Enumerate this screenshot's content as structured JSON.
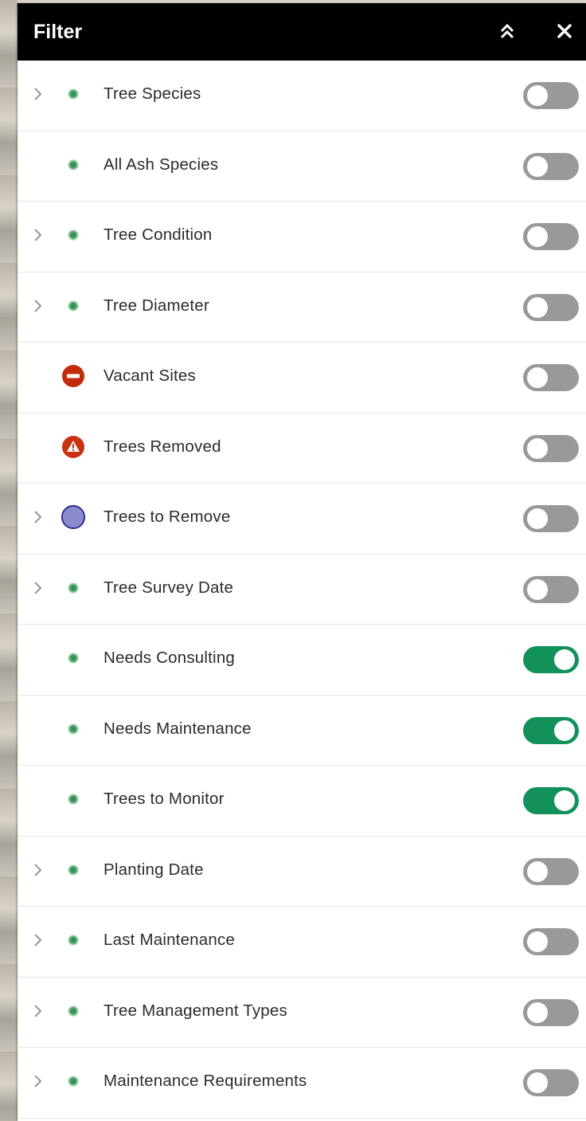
{
  "panel": {
    "title": "Filter",
    "collapse_icon": "double-chevron-up-icon",
    "close_icon": "close-icon"
  },
  "colors": {
    "header_bg": "#000000",
    "toggle_on": "#12915a",
    "toggle_off": "#999999",
    "tree_symbol": "#3e9c5c",
    "vacant_symbol": "#c22b0a",
    "removed_symbol": "#c8320f",
    "to_remove_symbol": "#8a8acc"
  },
  "filters": [
    {
      "label": "Tree Species",
      "expandable": true,
      "symbol": "tree-dot-icon",
      "enabled": false
    },
    {
      "label": "All Ash Species",
      "expandable": false,
      "symbol": "tree-dot-icon",
      "enabled": false
    },
    {
      "label": "Tree Condition",
      "expandable": true,
      "symbol": "tree-dot-icon",
      "enabled": false
    },
    {
      "label": "Tree Diameter",
      "expandable": true,
      "symbol": "tree-dot-icon",
      "enabled": false
    },
    {
      "label": "Vacant Sites",
      "expandable": false,
      "symbol": "no-entry-icon",
      "enabled": false
    },
    {
      "label": "Trees Removed",
      "expandable": false,
      "symbol": "warning-icon",
      "enabled": false
    },
    {
      "label": "Trees to Remove",
      "expandable": true,
      "symbol": "purple-circle-icon",
      "enabled": false
    },
    {
      "label": "Tree Survey Date",
      "expandable": true,
      "symbol": "tree-dot-icon",
      "enabled": false
    },
    {
      "label": "Needs Consulting",
      "expandable": false,
      "symbol": "tree-dot-icon",
      "enabled": true
    },
    {
      "label": "Needs Maintenance",
      "expandable": false,
      "symbol": "tree-dot-icon",
      "enabled": true
    },
    {
      "label": "Trees to Monitor",
      "expandable": false,
      "symbol": "tree-dot-icon",
      "enabled": true
    },
    {
      "label": "Planting Date",
      "expandable": true,
      "symbol": "tree-dot-icon",
      "enabled": false
    },
    {
      "label": "Last Maintenance",
      "expandable": true,
      "symbol": "tree-dot-icon",
      "enabled": false
    },
    {
      "label": "Tree Management Types",
      "expandable": true,
      "symbol": "tree-dot-icon",
      "enabled": false
    },
    {
      "label": "Maintenance Requirements",
      "expandable": true,
      "symbol": "tree-dot-icon",
      "enabled": false
    }
  ]
}
